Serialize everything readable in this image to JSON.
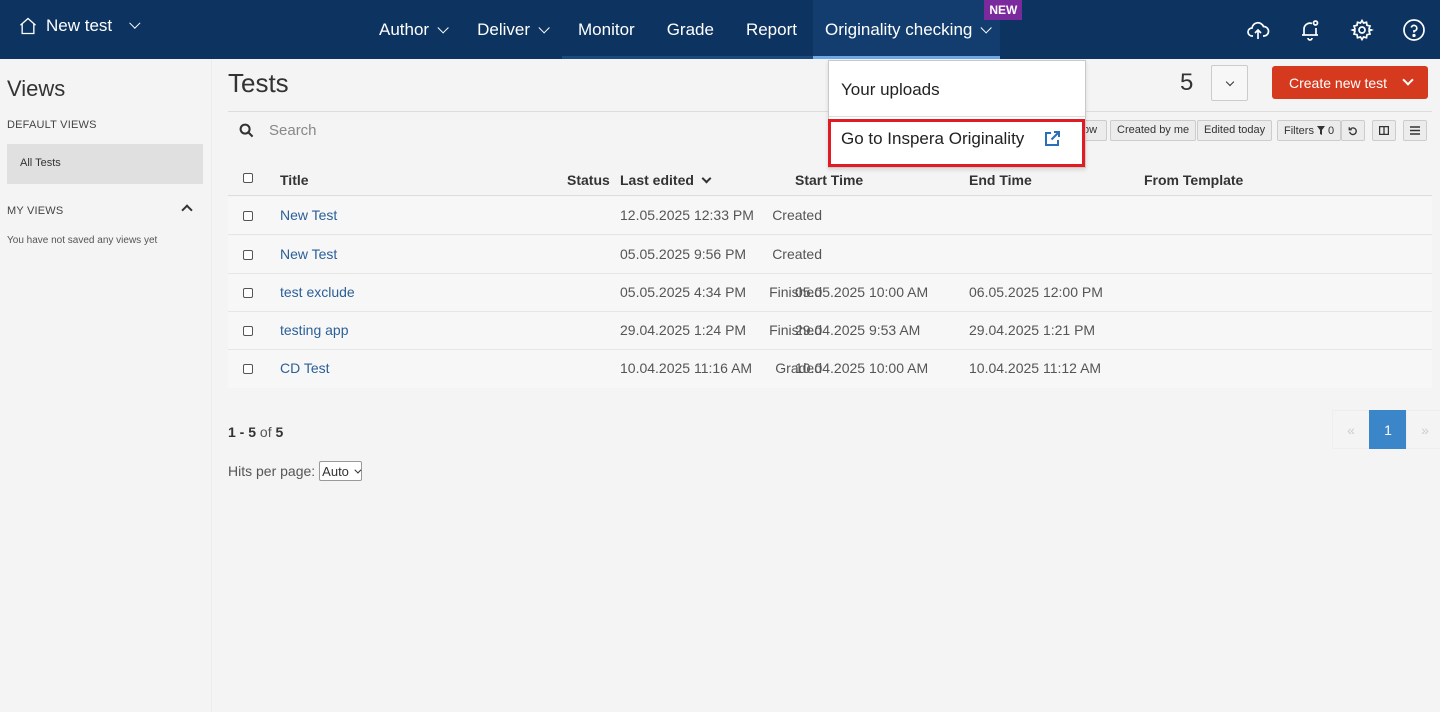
{
  "header": {
    "project_title": "New test",
    "nav": [
      {
        "label": "Author",
        "has_caret": true
      },
      {
        "label": "Deliver",
        "has_caret": true
      },
      {
        "label": "Monitor",
        "has_caret": false
      },
      {
        "label": "Grade",
        "has_caret": false
      },
      {
        "label": "Report",
        "has_caret": false
      },
      {
        "label": "Originality checking",
        "has_caret": true,
        "badge": "NEW"
      }
    ],
    "icons": [
      "cloud-upload-icon",
      "bell-icon",
      "gear-icon",
      "help-icon"
    ]
  },
  "dropdown": {
    "items": [
      "Your uploads",
      "Go to Inspera Originality"
    ],
    "highlight_color": "#e01b24"
  },
  "sidebar": {
    "title": "Views",
    "default_views_label": "DEFAULT VIEWS",
    "all_tests_label": "All Tests",
    "my_views_label": "MY VIEWS",
    "empty_text": "You have not saved any views yet"
  },
  "main": {
    "title": "Tests",
    "count": "5",
    "create_button": "Create new test",
    "search_placeholder": "Search",
    "chips": [
      "ow",
      "Created by me",
      "Edited today",
      "Filters",
      "0"
    ],
    "columns": [
      "Title",
      "Status",
      "Last edited",
      "Start Time",
      "End Time",
      "From Template"
    ],
    "rows": [
      {
        "title": "New Test",
        "status": "Created",
        "last_edited": "12.05.2025 12:33 PM",
        "start": "",
        "end": ""
      },
      {
        "title": "New Test",
        "status": "Created",
        "last_edited": "05.05.2025 9:56 PM",
        "start": "",
        "end": ""
      },
      {
        "title": "test exclude",
        "status": "Finished",
        "last_edited": "05.05.2025 4:34 PM",
        "start": "05.05.2025 10:00 AM",
        "end": "06.05.2025 12:00 PM"
      },
      {
        "title": "testing app",
        "status": "Finished",
        "last_edited": "29.04.2025 1:24 PM",
        "start": "29.04.2025 9:53 AM",
        "end": "29.04.2025 1:21 PM"
      },
      {
        "title": "CD Test",
        "status": "Graded",
        "last_edited": "10.04.2025 11:16 AM",
        "start": "10.04.2025 10:00 AM",
        "end": "10.04.2025 11:12 AM"
      }
    ],
    "range_from_to": "1 - 5",
    "range_of": "of",
    "range_total": "5",
    "hits_label": "Hits per page:",
    "hits_value": "Auto",
    "pagination": {
      "prev": "«",
      "current": "1",
      "next": "»"
    }
  },
  "colors": {
    "topbar": "#0d3460",
    "accent_red": "#d53a1e",
    "link_blue": "#2a5f98",
    "badge_purple": "#7b2a9e",
    "page_active": "#3a86c8"
  }
}
